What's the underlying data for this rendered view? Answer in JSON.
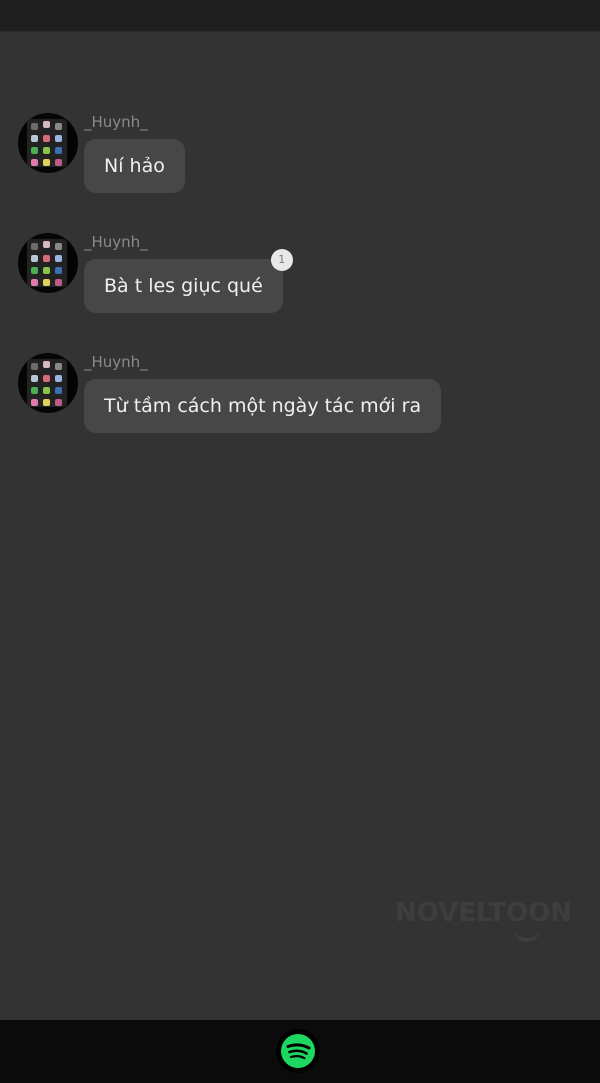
{
  "messages": [
    {
      "username": "_Huynh_",
      "text": "Ní hảo"
    },
    {
      "username": "_Huynh_",
      "text": "Bà t les giục qué",
      "badge": "1"
    },
    {
      "username": "_Huynh_",
      "text": "Từ tầm cách một ngày tác mới ra"
    }
  ],
  "watermark": "NOVELTOON",
  "colors": {
    "background": "#333333",
    "bubble": "#474747",
    "username": "#8a8a8a",
    "spotify_green": "#1ed760"
  },
  "icons": {
    "bottom_button": "spotify-icon"
  }
}
